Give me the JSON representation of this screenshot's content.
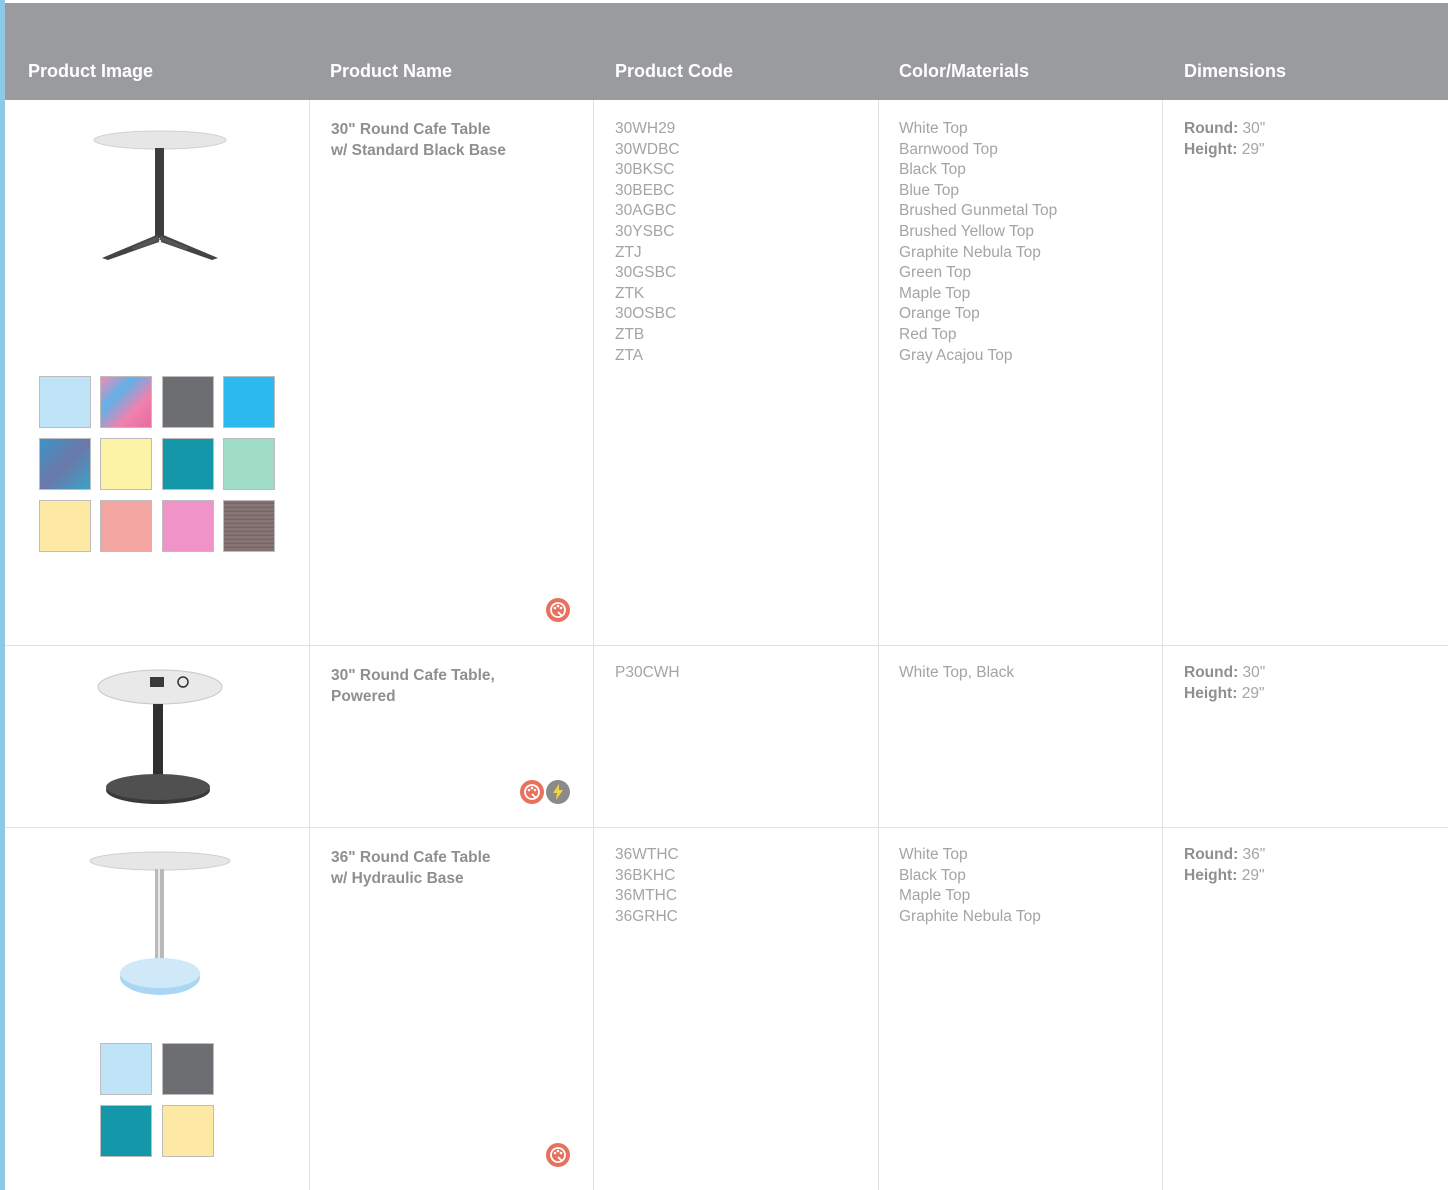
{
  "header": {
    "col_image": "Product Image",
    "col_name": "Product Name",
    "col_code": "Product Code",
    "col_color": "Color/Materials",
    "col_dims": "Dimensions"
  },
  "rows": [
    {
      "name_line1": "30\" Round Cafe Table",
      "name_line2": "w/ Standard Black Base",
      "codes": [
        "30WH29",
        "30WDBC",
        "30BKSC",
        "30BEBC",
        "30AGBC",
        "30YSBC",
        "ZTJ",
        "30GSBC",
        "ZTK",
        "30OSBC",
        "ZTB",
        "ZTA"
      ],
      "colors": [
        "White Top",
        "Barnwood Top",
        "Black Top",
        "Blue Top",
        "Brushed Gunmetal Top",
        "Brushed Yellow Top",
        "Graphite Nebula Top",
        "Green Top",
        "Maple Top",
        "Orange Top",
        "Red Top",
        "Gray Acajou Top"
      ],
      "dims": {
        "round_label": "Round:",
        "round": "30\"",
        "height_label": "Height:",
        "height": "29\""
      },
      "badges": [
        "palette-icon"
      ]
    },
    {
      "name_line1": "30\" Round Cafe Table,",
      "name_line2": "Powered",
      "codes": [
        "P30CWH"
      ],
      "colors": [
        "White Top, Black"
      ],
      "dims": {
        "round_label": "Round:",
        "round": "30\"",
        "height_label": "Height:",
        "height": "29\""
      },
      "badges": [
        "palette-icon",
        "power-bolt-icon"
      ]
    },
    {
      "name_line1": "36\" Round Cafe Table",
      "name_line2": "w/ Hydraulic Base",
      "codes": [
        "36WTHC",
        "36BKHC",
        "36MTHC",
        "36GRHC"
      ],
      "colors": [
        "White Top",
        "Black Top",
        "Maple Top",
        "Graphite Nebula Top"
      ],
      "dims": {
        "round_label": "Round:",
        "round": "36\"",
        "height_label": "Height:",
        "height": "29\""
      },
      "badges": [
        "palette-icon"
      ]
    }
  ],
  "colors": {
    "header_bg": "#9a9b9e",
    "accent_left": "#8fc9e8",
    "badge_palette": "#e8705e",
    "badge_power": "#8a8a8a"
  }
}
